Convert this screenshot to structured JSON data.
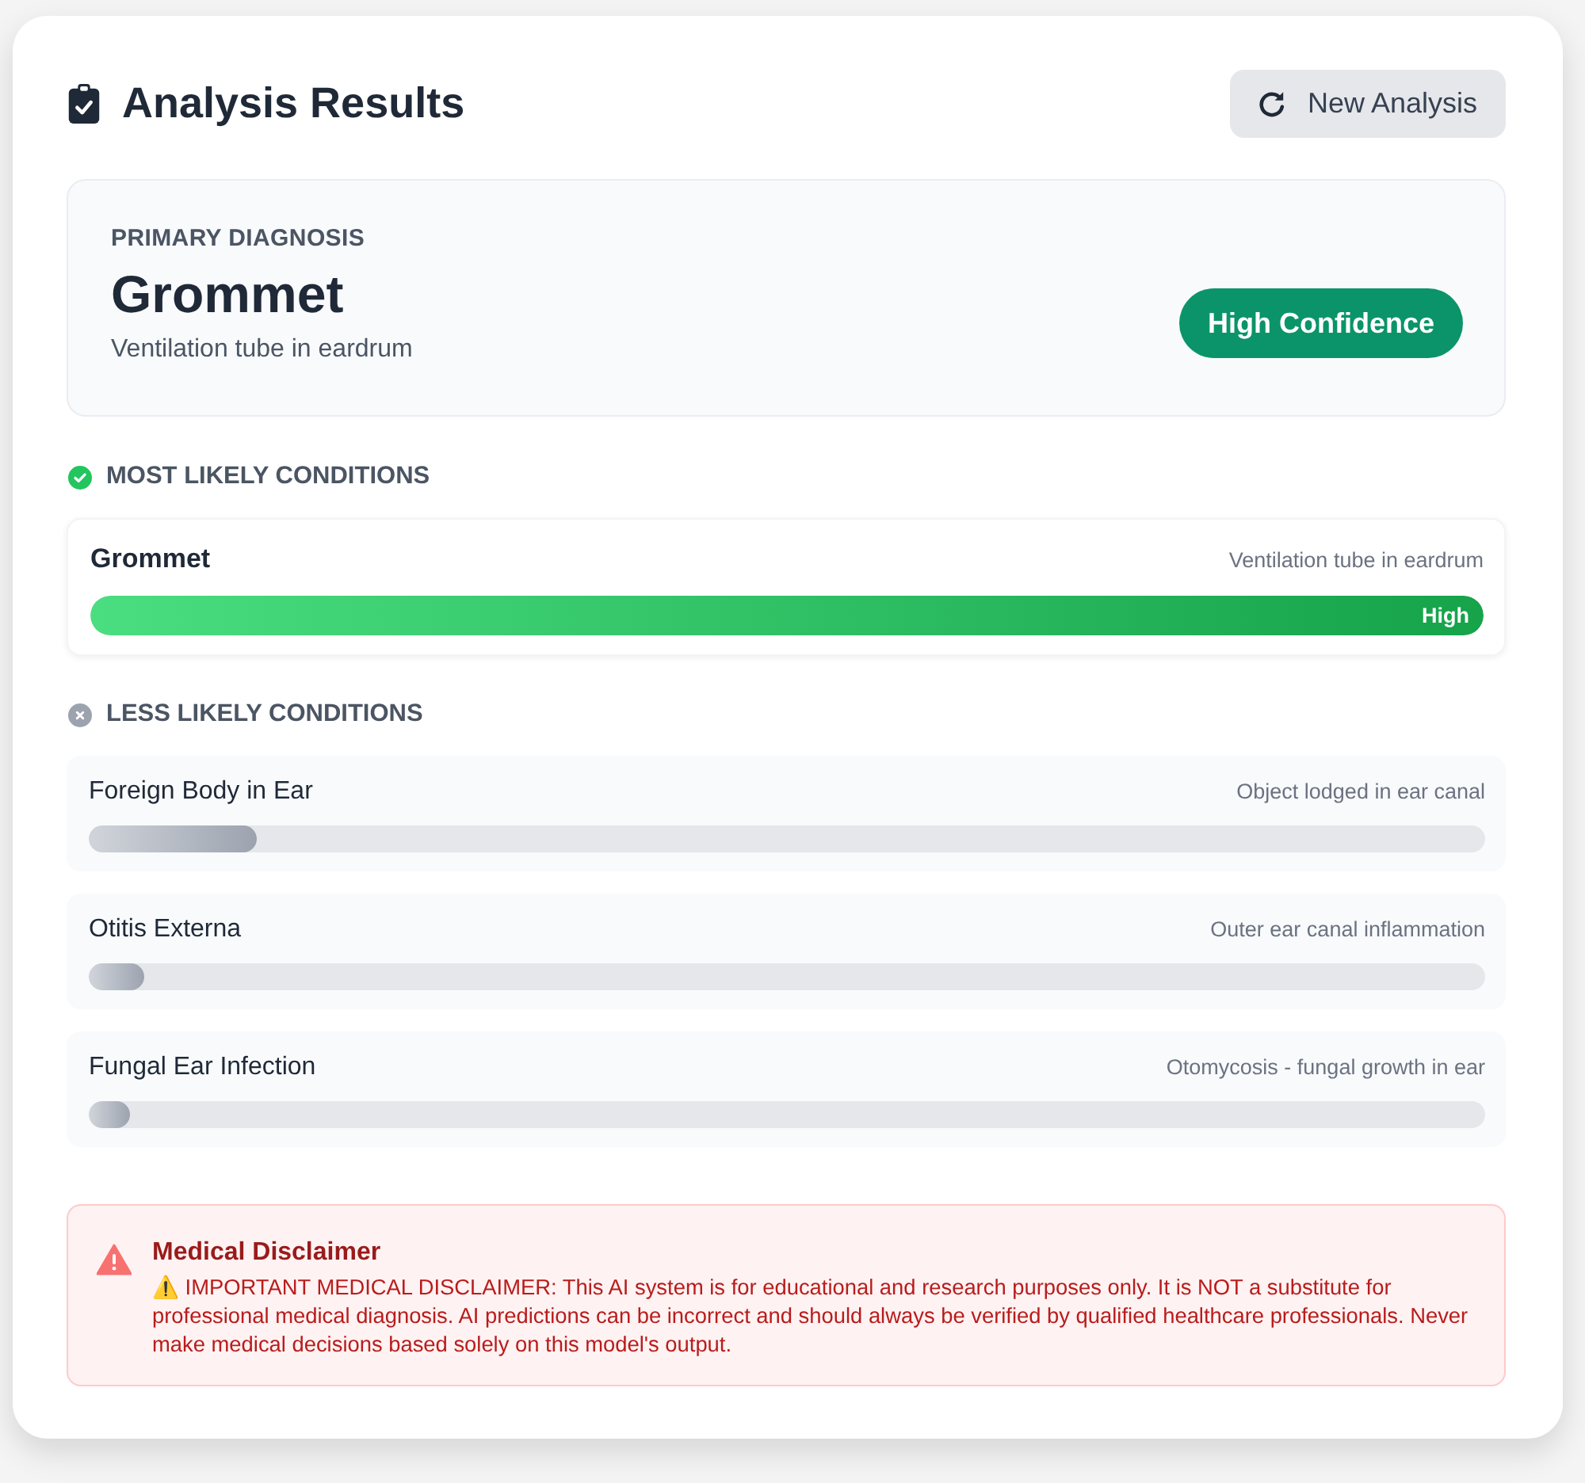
{
  "header": {
    "title": "Analysis Results",
    "button": "New Analysis"
  },
  "primary": {
    "label": "PRIMARY DIAGNOSIS",
    "name": "Grommet",
    "description": "Ventilation tube in eardrum",
    "badge": "High Confidence"
  },
  "sections": [
    {
      "kind": "likely",
      "heading": "MOST LIKELY CONDITIONS",
      "conditions": [
        {
          "name": "Grommet",
          "description": "Ventilation tube in eardrum",
          "level": 1,
          "bar_label": "High"
        }
      ]
    },
    {
      "kind": "unlikely",
      "heading": "LESS LIKELY CONDITIONS",
      "conditions": [
        {
          "name": "Foreign Body in Ear",
          "description": "Object lodged in ear canal",
          "level": 0.12
        },
        {
          "name": "Otitis Externa",
          "description": "Outer ear canal inflammation",
          "level": 0.04
        },
        {
          "name": "Fungal Ear Infection",
          "description": "Otomycosis - fungal growth in ear",
          "level": 0.03
        }
      ]
    }
  ],
  "disclaimer": {
    "title": "Medical Disclaimer",
    "text": "⚠️ IMPORTANT MEDICAL DISCLAIMER: This AI system is for educational and research purposes only. It is NOT a substitute for professional medical diagnosis. AI predictions can be incorrect and should always be verified by qualified healthcare professionals. Never make medical decisions based solely on this model's output."
  }
}
